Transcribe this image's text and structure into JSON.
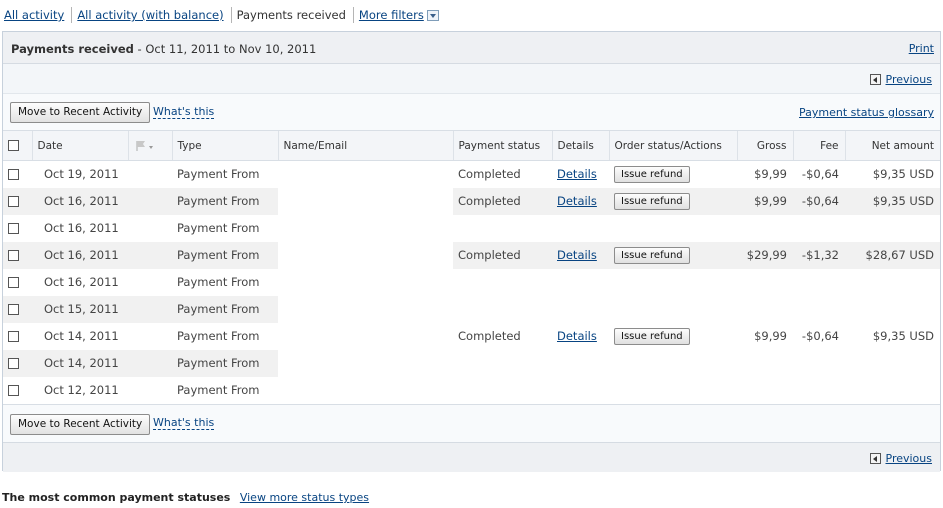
{
  "tabs": {
    "all_activity": "All activity",
    "all_activity_balance": "All activity (with balance)",
    "payments_received": "Payments received",
    "more_filters": "More filters"
  },
  "panel": {
    "title_bold": "Payments received",
    "title_range": " - Oct 11, 2011 to Nov 10, 2011",
    "print": "Print",
    "previous": "Previous",
    "move_button": "Move to Recent Activity",
    "whats_this": "What's this",
    "glossary": "Payment status glossary"
  },
  "columns": {
    "date": "Date",
    "type": "Type",
    "name": "Name/Email",
    "status": "Payment status",
    "details": "Details",
    "order": "Order status/Actions",
    "gross": "Gross",
    "fee": "Fee",
    "net": "Net amount"
  },
  "rows": [
    {
      "date": "Oct 19, 2011",
      "type": "Payment From",
      "status": "Completed",
      "details": "Details",
      "action": "Issue refund",
      "gross": "$9,99",
      "fee": "-$0,64",
      "net": "$9,35 USD"
    },
    {
      "date": "Oct 16, 2011",
      "type": "Payment From",
      "status": "Completed",
      "details": "Details",
      "action": "Issue refund",
      "gross": "$9,99",
      "fee": "-$0,64",
      "net": "$9,35 USD"
    },
    {
      "date": "Oct 16, 2011",
      "type": "Payment From",
      "status": "",
      "details": "",
      "action": "",
      "gross": "",
      "fee": "",
      "net": ""
    },
    {
      "date": "Oct 16, 2011",
      "type": "Payment From",
      "status": "Completed",
      "details": "Details",
      "action": "Issue refund",
      "gross": "$29,99",
      "fee": "-$1,32",
      "net": "$28,67 USD"
    },
    {
      "date": "Oct 16, 2011",
      "type": "Payment From",
      "status": "",
      "details": "",
      "action": "",
      "gross": "",
      "fee": "",
      "net": ""
    },
    {
      "date": "Oct 15, 2011",
      "type": "Payment From",
      "status": "",
      "details": "",
      "action": "",
      "gross": "",
      "fee": "",
      "net": ""
    },
    {
      "date": "Oct 14, 2011",
      "type": "Payment From",
      "status": "Completed",
      "details": "Details",
      "action": "Issue refund",
      "gross": "$9,99",
      "fee": "-$0,64",
      "net": "$9,35 USD"
    },
    {
      "date": "Oct 14, 2011",
      "type": "Payment From",
      "status": "",
      "details": "",
      "action": "",
      "gross": "",
      "fee": "",
      "net": ""
    },
    {
      "date": "Oct 12, 2011",
      "type": "Payment From",
      "status": "",
      "details": "",
      "action": "",
      "gross": "",
      "fee": "",
      "net": ""
    }
  ],
  "footer": {
    "label": "The most common payment statuses",
    "link": "View more status types"
  }
}
